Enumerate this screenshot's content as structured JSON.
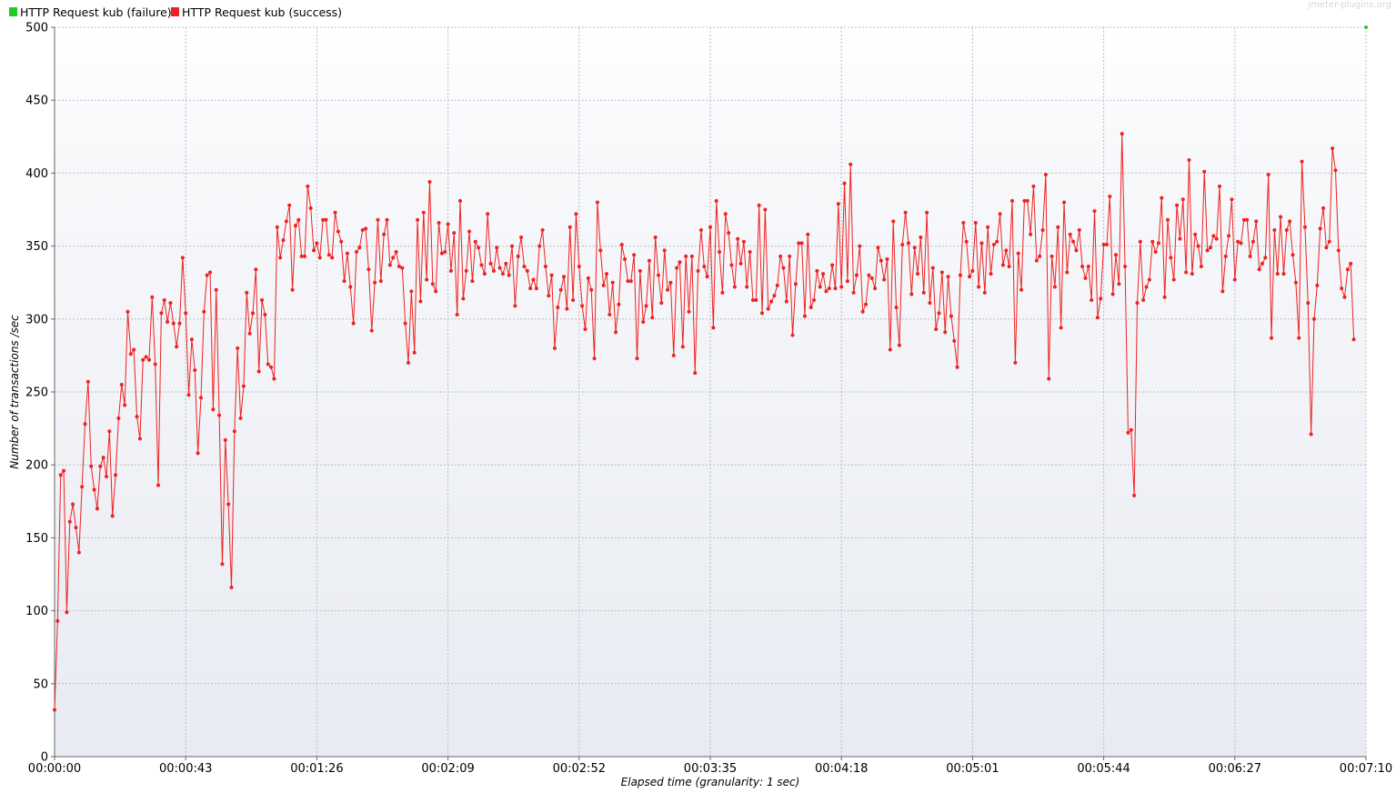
{
  "watermark": "jmeter-plugins.org",
  "chart_data": {
    "type": "line",
    "xlabel": "Elapsed time (granularity: 1 sec)",
    "ylabel": "Number of transactions /sec",
    "xlim": [
      0,
      430
    ],
    "ylim": [
      0,
      500
    ],
    "y_ticks": [
      0,
      50,
      100,
      150,
      200,
      250,
      300,
      350,
      400,
      450,
      500
    ],
    "x_ticks": [
      {
        "x": 0,
        "label": "00:00:00"
      },
      {
        "x": 43,
        "label": "00:00:43"
      },
      {
        "x": 86,
        "label": "00:01:26"
      },
      {
        "x": 129,
        "label": "00:02:09"
      },
      {
        "x": 172,
        "label": "00:02:52"
      },
      {
        "x": 215,
        "label": "00:03:35"
      },
      {
        "x": 258,
        "label": "00:04:18"
      },
      {
        "x": 301,
        "label": "00:05:01"
      },
      {
        "x": 344,
        "label": "00:05:44"
      },
      {
        "x": 387,
        "label": "00:06:27"
      },
      {
        "x": 430,
        "label": "00:07:10"
      }
    ],
    "grid": true,
    "legend_position": "top-left",
    "series": [
      {
        "name": "HTTP Request kub (failure)",
        "color": "#22cc22",
        "x": [
          430
        ],
        "values": [
          500
        ]
      },
      {
        "name": "HTTP Request kub (success)",
        "color": "#ee2222",
        "x_start": 0,
        "x_step": 1,
        "values": [
          32,
          93,
          193,
          196,
          99,
          161,
          173,
          157,
          140,
          185,
          228,
          257,
          199,
          183,
          170,
          199,
          205,
          192,
          223,
          165,
          193,
          232,
          255,
          241,
          305,
          276,
          279,
          233,
          218,
          272,
          274,
          272,
          315,
          269,
          186,
          304,
          313,
          298,
          311,
          297,
          281,
          297,
          342,
          304,
          248,
          286,
          265,
          208,
          246,
          305,
          330,
          332,
          238,
          320,
          234,
          132,
          217,
          173,
          116,
          223,
          280,
          232,
          254,
          318,
          290,
          304,
          334,
          264,
          313,
          303,
          269,
          267,
          259,
          363,
          342,
          354,
          367,
          378,
          320,
          364,
          368,
          343,
          343,
          391,
          376,
          347,
          352,
          342,
          368,
          368,
          344,
          342,
          373,
          360,
          353,
          326,
          345,
          322,
          297,
          346,
          349,
          361,
          362,
          334,
          292,
          325,
          368,
          326,
          358,
          368,
          337,
          342,
          346,
          336,
          335,
          297,
          270,
          319,
          277,
          368,
          312,
          373,
          327,
          394,
          324,
          319,
          366,
          345,
          346,
          365,
          333,
          359,
          303,
          381,
          314,
          333,
          360,
          326,
          353,
          349,
          337,
          331,
          372,
          338,
          333,
          349,
          335,
          331,
          338,
          330,
          350,
          309,
          343,
          356,
          336,
          333,
          321,
          327,
          321,
          350,
          361,
          336,
          316,
          330,
          280,
          308,
          320,
          329,
          307,
          363,
          313,
          372,
          336,
          309,
          293,
          328,
          320,
          273,
          380,
          347,
          323,
          331,
          303,
          325,
          291,
          310,
          351,
          341,
          326,
          326,
          344,
          273,
          333,
          298,
          309,
          340,
          301,
          356,
          330,
          311,
          347,
          320,
          325,
          275,
          335,
          339,
          281,
          343,
          305,
          343,
          263,
          333,
          361,
          336,
          329,
          363,
          294,
          381,
          346,
          318,
          372,
          359,
          337,
          322,
          355,
          338,
          353,
          322,
          346,
          313,
          313,
          378,
          304,
          375,
          307,
          312,
          316,
          323,
          343,
          335,
          312,
          343,
          289,
          324,
          352,
          352,
          302,
          358,
          308,
          313,
          333,
          322,
          331,
          319,
          321,
          337,
          321,
          379,
          322,
          393,
          326,
          406,
          318,
          330,
          350,
          305,
          310,
          330,
          328,
          321,
          349,
          340,
          327,
          341,
          279,
          367,
          308,
          282,
          351,
          373,
          352,
          317,
          349,
          331,
          356,
          318,
          373,
          311,
          335,
          293,
          304,
          332,
          291,
          329,
          302,
          285,
          267,
          330,
          366,
          353,
          329,
          333,
          366,
          322,
          352,
          318,
          363,
          331,
          351,
          353,
          372,
          337,
          347,
          336,
          381,
          270,
          345,
          320,
          381,
          381,
          358,
          391,
          340,
          343,
          361,
          399,
          259,
          343,
          322,
          363,
          294,
          380,
          332,
          358,
          353,
          347,
          361,
          336,
          328,
          336,
          313,
          374,
          301,
          314,
          351,
          351,
          384,
          317,
          344,
          324,
          427,
          336,
          222,
          224,
          179,
          311,
          353,
          313,
          322,
          327,
          353,
          346,
          352,
          383,
          315,
          368,
          342,
          327,
          378,
          355,
          382,
          332,
          409,
          331,
          358,
          350,
          336,
          401,
          347,
          349,
          357,
          355,
          391,
          319,
          343,
          357,
          382,
          327,
          353,
          352,
          368,
          368,
          343,
          353,
          367,
          334,
          338,
          342,
          399,
          287,
          361,
          331,
          370,
          331,
          361,
          367,
          344,
          325,
          287,
          408,
          363,
          311,
          221,
          300,
          323,
          362,
          376,
          349,
          353,
          417,
          402,
          347,
          321,
          315,
          334,
          338,
          286
        ]
      }
    ]
  }
}
